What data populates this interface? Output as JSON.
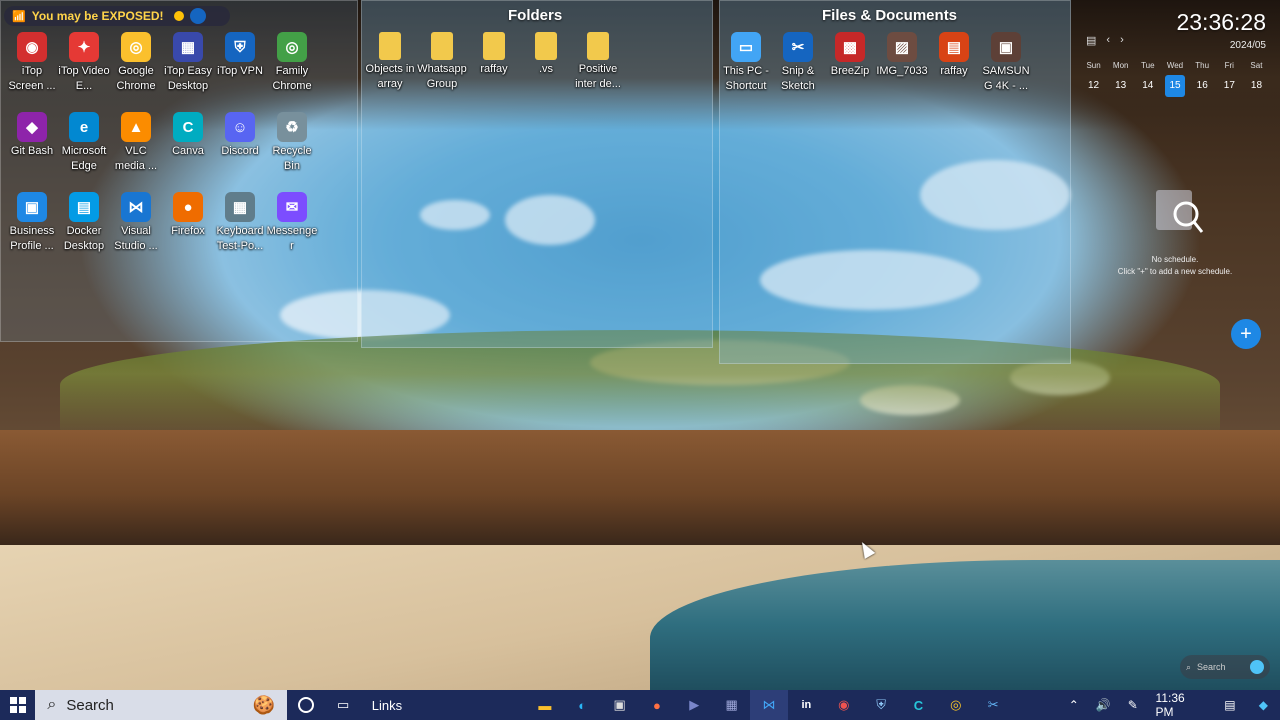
{
  "notification": {
    "text": "You may be EXPOSED!"
  },
  "fences": {
    "folders_title": "Folders",
    "files_title": "Files & Documents"
  },
  "desktop_icons": [
    {
      "label": "iTop Screen ...",
      "color": "#d32f2f",
      "glyph": "◉"
    },
    {
      "label": "iTop Video E...",
      "color": "#e53935",
      "glyph": "✦"
    },
    {
      "label": "Google Chrome",
      "color": "#fbc02d",
      "glyph": "◎"
    },
    {
      "label": "iTop Easy Desktop",
      "color": "#3949ab",
      "glyph": "▦"
    },
    {
      "label": "iTop VPN",
      "color": "#1565c0",
      "glyph": "⛨"
    },
    {
      "label": "Family Chrome",
      "color": "#43a047",
      "glyph": "◎"
    },
    {
      "label": "Git Bash",
      "color": "#8e24aa",
      "glyph": "◆"
    },
    {
      "label": "Microsoft Edge",
      "color": "#0288d1",
      "glyph": "e"
    },
    {
      "label": "VLC media ...",
      "color": "#fb8c00",
      "glyph": "▲"
    },
    {
      "label": "Canva",
      "color": "#00acc1",
      "glyph": "C"
    },
    {
      "label": "Discord",
      "color": "#5865f2",
      "glyph": "☺"
    },
    {
      "label": "Recycle Bin",
      "color": "#78909c",
      "glyph": "♻"
    },
    {
      "label": "Business Profile ...",
      "color": "#1e88e5",
      "glyph": "▣"
    },
    {
      "label": "Docker Desktop",
      "color": "#039be5",
      "glyph": "▤"
    },
    {
      "label": "Visual Studio ...",
      "color": "#1976d2",
      "glyph": "⋈"
    },
    {
      "label": "Firefox",
      "color": "#ef6c00",
      "glyph": "●"
    },
    {
      "label": "Keyboard Test-Po...",
      "color": "#607d8b",
      "glyph": "▦"
    },
    {
      "label": "Messenger",
      "color": "#7c4dff",
      "glyph": "✉"
    }
  ],
  "folder_icons": [
    {
      "label": "Objects in array"
    },
    {
      "label": "Whatsapp Group"
    },
    {
      "label": "raffay"
    },
    {
      "label": ".vs"
    },
    {
      "label": "Positive inter de..."
    }
  ],
  "file_icons": [
    {
      "label": "This PC - Shortcut",
      "color": "#42a5f5",
      "glyph": "▭"
    },
    {
      "label": "Snip & Sketch",
      "color": "#1565c0",
      "glyph": "✂"
    },
    {
      "label": "BreeZip",
      "color": "#c62828",
      "glyph": "▩"
    },
    {
      "label": "IMG_7033",
      "color": "#6d4c41",
      "glyph": "▨"
    },
    {
      "label": "raffay",
      "color": "#d84315",
      "glyph": "▤"
    },
    {
      "label": "SAMSUNG 4K - ...",
      "color": "#5d4037",
      "glyph": "▣"
    }
  ],
  "widget": {
    "time": "23:36:28",
    "date": "2024/05",
    "days": [
      "Sun",
      "Mon",
      "Tue",
      "Wed",
      "Thu",
      "Fri",
      "Sat"
    ],
    "dates": [
      "12",
      "13",
      "14",
      "15",
      "16",
      "17",
      "18"
    ],
    "today": "15",
    "no_schedule": "No schedule.",
    "hint": "Click \"+\" to add a new schedule.",
    "add": "+",
    "search_placeholder": "Search"
  },
  "taskbar": {
    "search_label": "Search",
    "links_label": "Links",
    "time": "11:36 PM"
  }
}
